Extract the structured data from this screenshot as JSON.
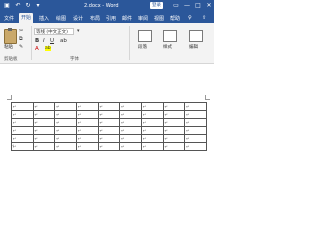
{
  "titlebar": {
    "save_icon": "save-icon",
    "undo_icon": "undo-icon",
    "redo_icon": "redo-icon",
    "customize_icon": "customize-quick-access-icon",
    "title": "2.docx - Word",
    "login_label": "登录",
    "minimize": "—",
    "maximize": "□",
    "close": "✕",
    "color": "#2b579a"
  },
  "tabs": [
    "文件",
    "开始",
    "插入",
    "绘图",
    "设计",
    "布局",
    "引用",
    "邮件",
    "审阅",
    "视图",
    "帮助"
  ],
  "tab_search_icon": "lightbulb-icon",
  "tab_share_icon": "share-icon",
  "ribbon": {
    "clipboard": {
      "paste_label": "粘贴",
      "group_label": "剪贴板"
    },
    "font": {
      "font_name": "等线 (中文正文)",
      "group_label": "字体",
      "bold": "B",
      "italic": "I",
      "underline": "U",
      "font_color": "A"
    },
    "paragraph": {
      "label": "段落"
    },
    "styles": {
      "label": "样式"
    },
    "editing": {
      "label": "编辑"
    }
  },
  "document": {
    "cell_mark": "↵",
    "para_mark": "↵",
    "rows": 6,
    "cols": 9
  }
}
